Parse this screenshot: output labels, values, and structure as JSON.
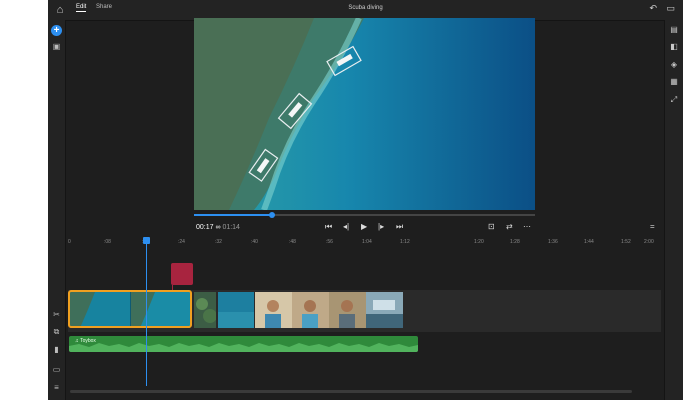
{
  "window": {
    "title": "Scuba diving"
  },
  "topbar": {
    "home_icon": "home-icon",
    "tabs": [
      {
        "label": "Edit",
        "active": true
      },
      {
        "label": "Share",
        "active": false
      }
    ],
    "undo_icon": "undo-icon",
    "feedback_icon": "feedback-icon"
  },
  "leftbar": {
    "add_icon": "plus-icon",
    "icons": [
      "media-icon",
      "scissors-icon",
      "duplicate-icon",
      "trash-icon",
      "split-icon",
      "align-icon"
    ]
  },
  "rightbar": {
    "icons": [
      "crop-icon",
      "adjust-icon",
      "color-icon",
      "text-icon",
      "transform-icon"
    ]
  },
  "player": {
    "current_time": "00:17",
    "separator": "∞",
    "duration": "01:14",
    "progress_fraction": 0.23,
    "controls": [
      "skip-start-icon",
      "step-back-icon",
      "play-icon",
      "step-forward-icon",
      "skip-end-icon"
    ],
    "extras": [
      "fit-icon",
      "loop-icon",
      "more-icon"
    ]
  },
  "ruler": {
    "ticks": [
      "0",
      ":08",
      ":16",
      ":24",
      ":32",
      ":40",
      ":48",
      ":56",
      "1:04",
      "1:12",
      "1:20",
      "1:28",
      "1:36",
      "1:44",
      "1:52",
      "2:00"
    ]
  },
  "timeline": {
    "audio_track_label": "Toybox",
    "colors": {
      "accent": "#2d8ff0",
      "selection": "#f0a020",
      "marker": "#a8243f",
      "audio": "#2f8a3b"
    }
  }
}
